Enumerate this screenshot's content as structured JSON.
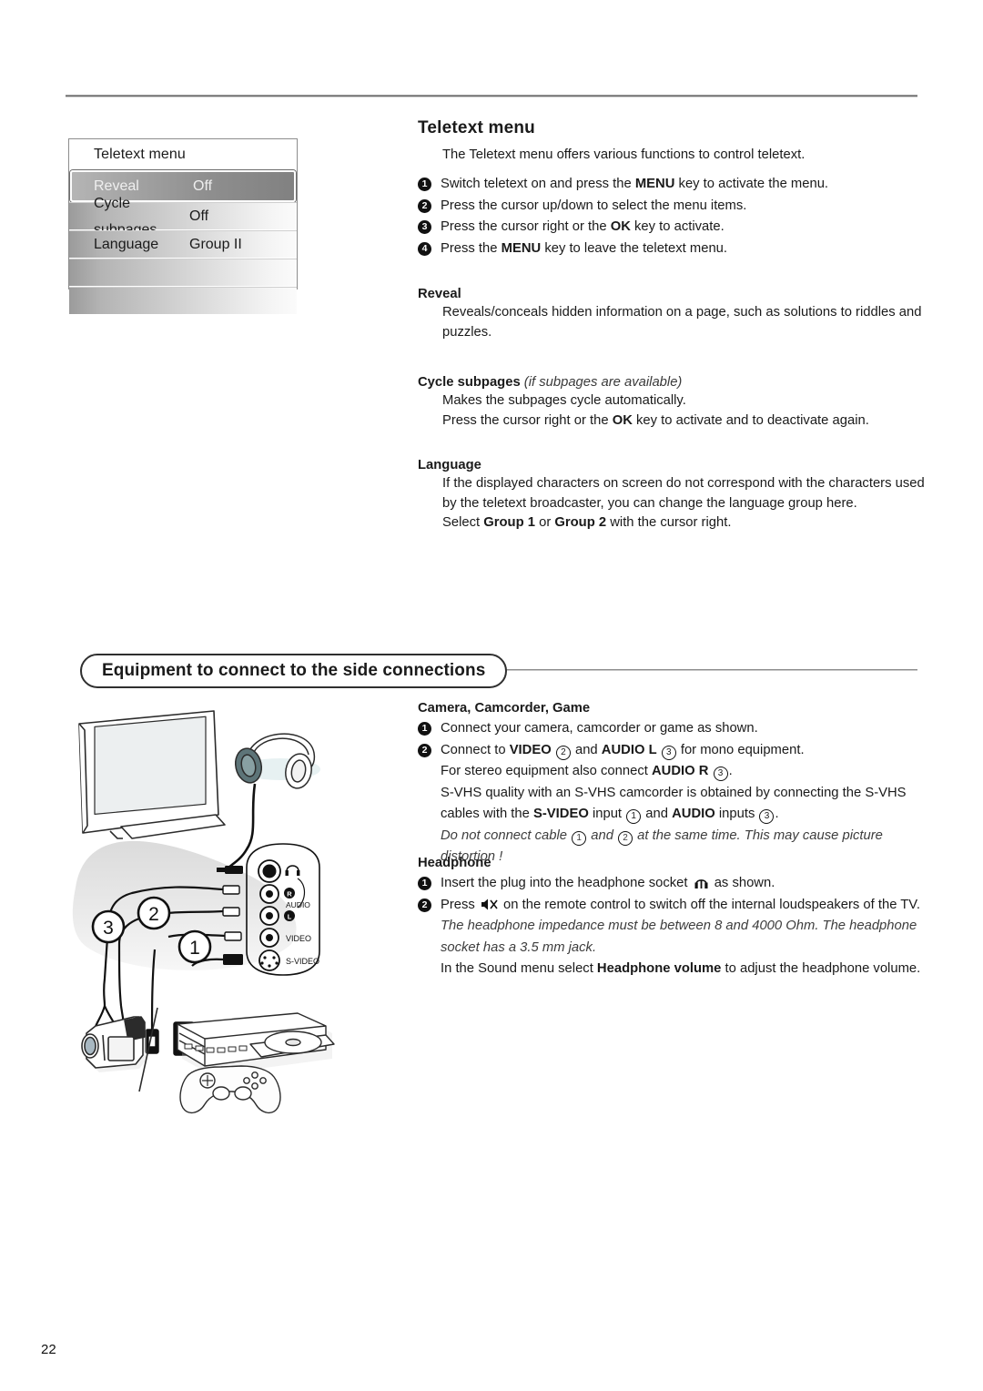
{
  "page": {
    "number": "22"
  },
  "osd": {
    "title": "Teletext menu",
    "rows": [
      {
        "label": "Reveal",
        "value": "Off",
        "selected": true
      },
      {
        "label": "Cycle subpages",
        "value": "Off",
        "selected": false
      },
      {
        "label": "Language",
        "value": "Group II",
        "selected": false
      },
      {
        "label": "",
        "value": "",
        "selected": false
      },
      {
        "label": "",
        "value": "",
        "selected": false
      }
    ]
  },
  "teletext": {
    "heading": "Teletext menu",
    "lead": "The Teletext menu offers various functions to control teletext.",
    "steps": [
      {
        "n": "1",
        "html": "Switch teletext on and press the <b>MENU</b> key to activate the menu."
      },
      {
        "n": "2",
        "html": "Press the cursor up/down to select the menu items."
      },
      {
        "n": "3",
        "html": "Press the cursor right or the <b>OK</b> key to activate."
      },
      {
        "n": "4",
        "html": "Press the <b>MENU</b> key to leave the teletext menu."
      }
    ],
    "reveal": {
      "title": "Reveal",
      "body": "Reveals/conceals hidden information on a page, such as solutions to riddles and puzzles."
    },
    "cycle": {
      "title": "Cycle subpages",
      "title_note": "(if subpages are available)",
      "line1": "Makes the subpages cycle automatically.",
      "line2_html": "Press the cursor right or the <b>OK</b> key to activate and to deactivate again."
    },
    "language": {
      "title": "Language",
      "body_html": "If the displayed characters on screen do not correspond with the characters used by the teletext broadcaster, you can change the language group here.<br>Select <b>Group 1</b> or <b>Group 2</b> with the cursor right."
    }
  },
  "equipment": {
    "heading": "Equipment to connect to the side connections",
    "camera": {
      "title": "Camera, Camcorder, Game",
      "steps": [
        {
          "n": "1",
          "html": "Connect your camera, camcorder or game as shown."
        },
        {
          "n": "2",
          "html": "Connect to <b>VIDEO</b> <span class=\"circnum\">2</span> and <b>AUDIO L</b> <span class=\"circnum\">3</span> for mono equipment."
        }
      ],
      "cont1_html": "For stereo equipment also connect <b>AUDIO R</b> <span class=\"circnum\">3</span>.",
      "cont2_html": "S-VHS quality with an S-VHS camcorder is obtained by connecting the S-VHS cables with the <b>S-VIDEO</b> input <span class=\"circnum\">1</span> and <b>AUDIO</b> inputs <span class=\"circnum\">3</span>.",
      "note_html": "Do not connect cable <span class=\"circnum\">1</span> and <span class=\"circnum\">2</span> at the same time. This may cause picture distortion !"
    },
    "headphone": {
      "title": "Headphone",
      "step1_html": "Insert the plug into the headphone socket HPICON as shown.",
      "step2_html": "Press MUTEICON on the remote control to switch off the internal loudspeakers of the TV.",
      "note_html": "The headphone impedance must be between 8 and 4000 Ohm. The headphone socket has a 3.5 mm jack.",
      "cont_html": "In the Sound menu select <b>Headphone volume</b> to adjust the headphone volume."
    }
  },
  "illustration": {
    "connector_labels": [
      "AUDIO",
      "VIDEO",
      "S-VIDEO"
    ],
    "audio_r": "R",
    "audio_l": "L",
    "callouts": [
      "1",
      "2",
      "3"
    ],
    "devices": [
      "tv-set",
      "headphones",
      "camcorder",
      "game-console",
      "game-controller"
    ]
  }
}
